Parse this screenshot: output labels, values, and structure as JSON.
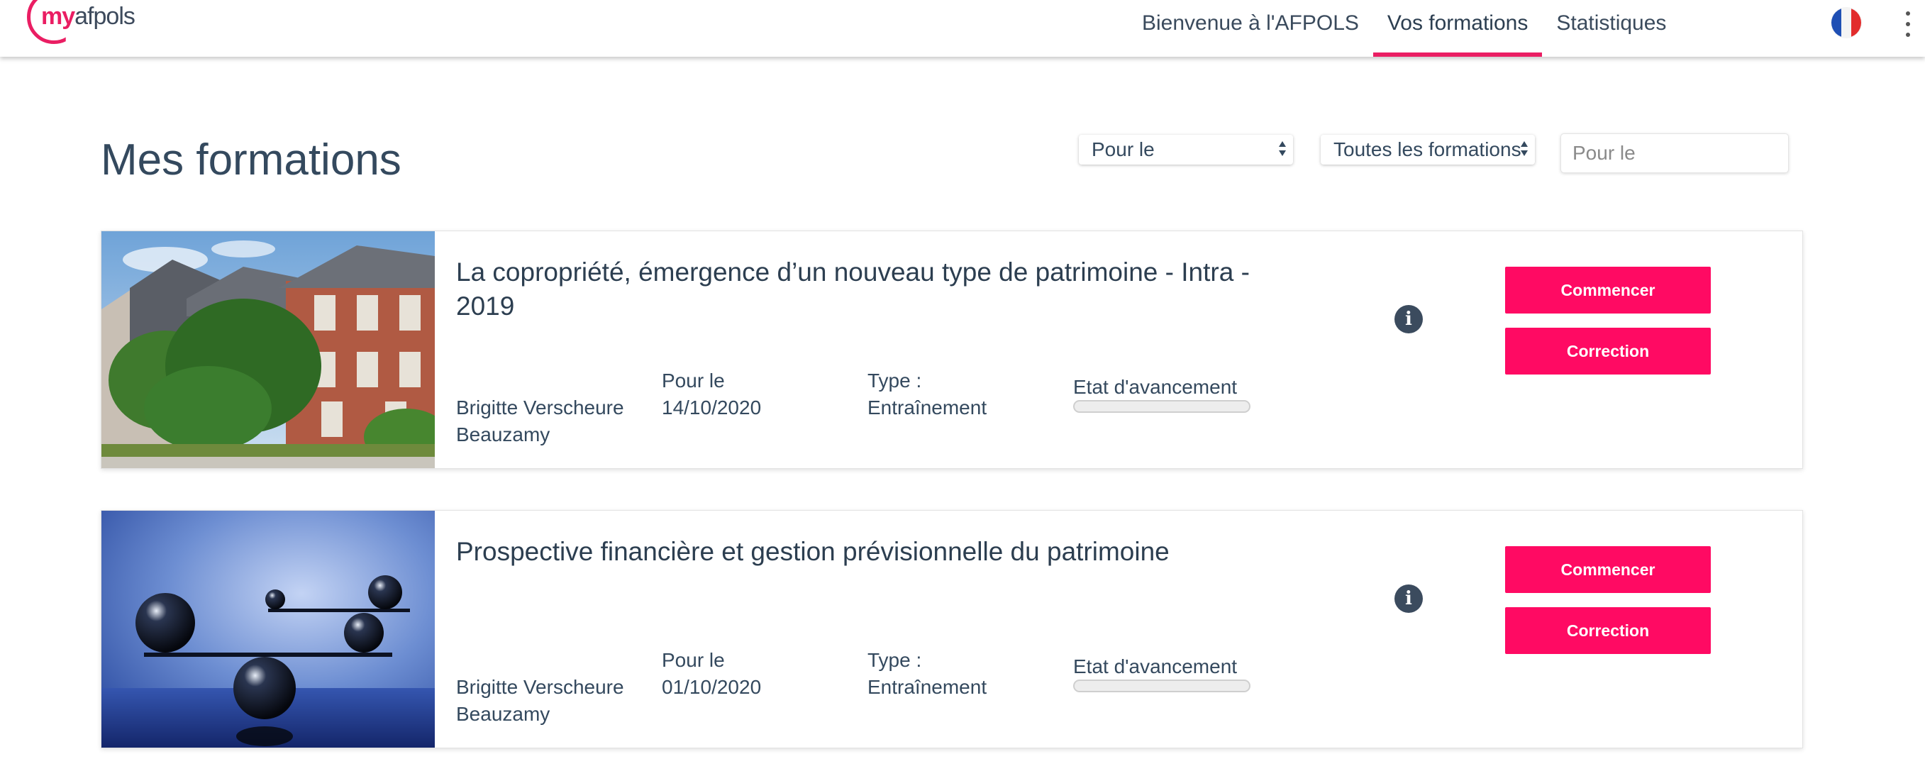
{
  "brand": {
    "logo_my": "my",
    "logo_afpols": "afpols",
    "accent_color": "#ff0a63"
  },
  "nav": {
    "items": [
      {
        "label": "Bienvenue à l'AFPOLS",
        "active": false
      },
      {
        "label": "Vos formations",
        "active": true
      },
      {
        "label": "Statistiques",
        "active": false
      }
    ],
    "language_icon": "france-flag-icon",
    "menu_icon": "kebab-menu-icon"
  },
  "page": {
    "title": "Mes formations",
    "filters": {
      "date_select": "Pour le",
      "formation_select": "Toutes les formations",
      "search_placeholder": "Pour le"
    }
  },
  "courses": [
    {
      "title": "La copropriété, émergence d’un nouveau type de patrimoine - Intra - 2019",
      "trainer": "Brigitte Verscheure Beauzamy",
      "date_label": "Pour le",
      "date": "14/10/2020",
      "type_label": "Type :",
      "type": "Entraînement",
      "progress_label": "Etat d'avancement",
      "progress": 0,
      "image": "apartment-buildings-photo",
      "start_label": "Commencer",
      "correction_label": "Correction"
    },
    {
      "title": "Prospective financière et gestion prévisionnelle du patrimoine",
      "trainer": "Brigitte Verscheure Beauzamy",
      "date_label": "Pour le",
      "date": "01/10/2020",
      "type_label": "Type :",
      "type": "Entraînement",
      "progress_label": "Etat d'avancement",
      "progress": 0,
      "image": "balancing-spheres-photo",
      "start_label": "Commencer",
      "correction_label": "Correction"
    }
  ]
}
